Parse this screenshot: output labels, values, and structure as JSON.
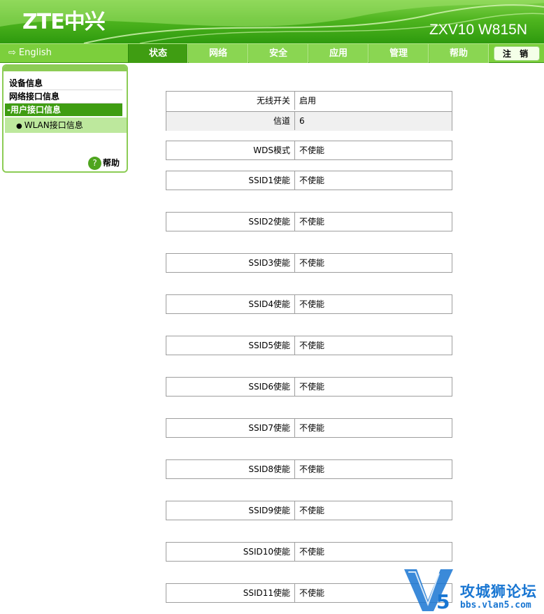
{
  "header": {
    "logo": "ZTE中兴",
    "model": "ZXV10 W815N"
  },
  "nav": {
    "language": "English",
    "tabs": [
      "状态",
      "网络",
      "安全",
      "应用",
      "管理",
      "帮助"
    ],
    "logout": "注 销"
  },
  "sidebar": {
    "items": [
      "设备信息",
      "网络接口信息",
      "-用户接口信息"
    ],
    "sub_item": "WLAN接口信息",
    "help": "帮助"
  },
  "content": {
    "wireless": {
      "label": "无线开关",
      "value": "启用"
    },
    "channel": {
      "label": "信道",
      "value": "6"
    },
    "wds": {
      "label": "WDS模式",
      "value": "不使能"
    },
    "ssids": [
      {
        "label": "SSID1使能",
        "value": "不使能"
      },
      {
        "label": "SSID2使能",
        "value": "不使能"
      },
      {
        "label": "SSID3使能",
        "value": "不使能"
      },
      {
        "label": "SSID4使能",
        "value": "不使能"
      },
      {
        "label": "SSID5使能",
        "value": "不使能"
      },
      {
        "label": "SSID6使能",
        "value": "不使能"
      },
      {
        "label": "SSID7使能",
        "value": "不使能"
      },
      {
        "label": "SSID8使能",
        "value": "不使能"
      },
      {
        "label": "SSID9使能",
        "value": "不使能"
      },
      {
        "label": "SSID10使能",
        "value": "不使能"
      },
      {
        "label": "SSID11使能",
        "value": "不使能"
      }
    ]
  },
  "watermark": {
    "title": "攻城狮论坛",
    "url": "bbs.vlan5.com"
  },
  "colors": {
    "brand_green": "#4fb51f",
    "active_tab": "#3f9d12",
    "watermark_blue": "#1976d2"
  }
}
